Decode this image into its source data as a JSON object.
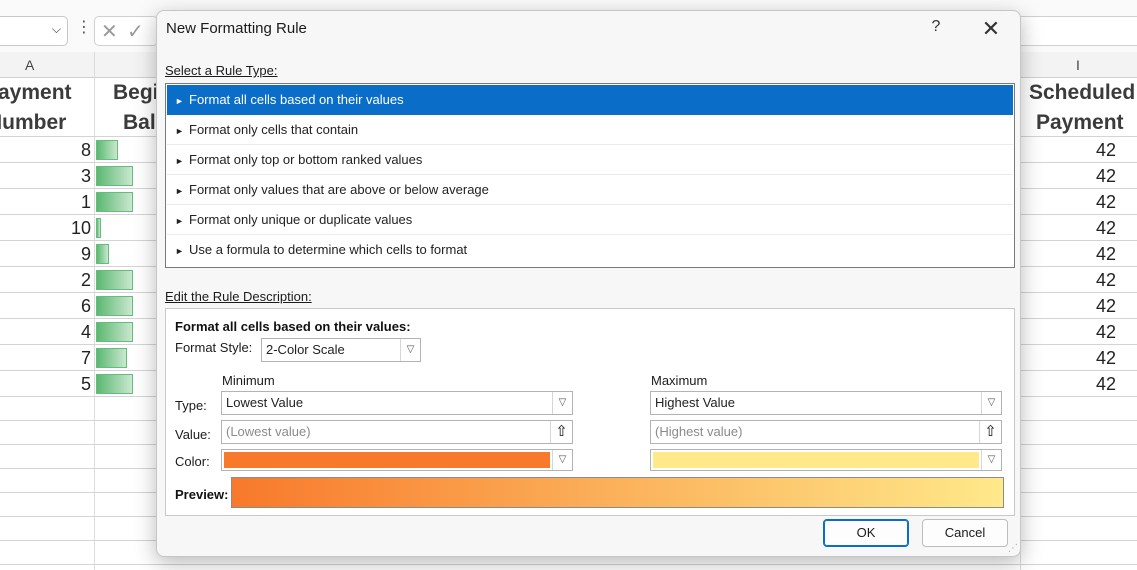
{
  "sheet": {
    "col_headers": [
      "A",
      "I"
    ],
    "header_cells": {
      "a_line1": "ayment",
      "a_line2": "Number",
      "b_line1": "Begi",
      "b_line2": "Bala",
      "i_line1": "Scheduled",
      "i_line2": "Payment"
    },
    "rows": [
      {
        "num": "8",
        "bar_fraction": 0.37,
        "payment": "42"
      },
      {
        "num": "3",
        "bar_fraction": 0.62,
        "payment": "42"
      },
      {
        "num": "1",
        "bar_fraction": 0.62,
        "payment": "42"
      },
      {
        "num": "10",
        "bar_fraction": 0.09,
        "payment": "42"
      },
      {
        "num": "9",
        "bar_fraction": 0.22,
        "payment": "42"
      },
      {
        "num": "2",
        "bar_fraction": 0.62,
        "payment": "42"
      },
      {
        "num": "6",
        "bar_fraction": 0.62,
        "payment": "42"
      },
      {
        "num": "4",
        "bar_fraction": 0.62,
        "payment": "42"
      },
      {
        "num": "7",
        "bar_fraction": 0.52,
        "payment": "42"
      },
      {
        "num": "5",
        "bar_fraction": 0.62,
        "payment": "42"
      }
    ],
    "databar_color": "#63be7b"
  },
  "dialog": {
    "title": "New Formatting Rule",
    "help_label": "?",
    "close_label": "✕",
    "select_rule_label": "Select a Rule Type:",
    "rule_types": [
      "Format all cells based on their values",
      "Format only cells that contain",
      "Format only top or bottom ranked values",
      "Format only values that are above or below average",
      "Format only unique or duplicate values",
      "Use a formula to determine which cells to format"
    ],
    "selected_rule_index": 0,
    "edit_rule_label": "Edit the Rule Description:",
    "description": {
      "heading": "Format all cells based on their values:",
      "format_style_label": "Format Style:",
      "format_style_value": "2-Color Scale",
      "minimum_label": "Minimum",
      "maximum_label": "Maximum",
      "type_label": "Type:",
      "value_label": "Value:",
      "color_label": "Color:",
      "min_type": "Lowest Value",
      "max_type": "Highest Value",
      "min_value_placeholder": "(Lowest value)",
      "max_value_placeholder": "(Highest value)",
      "min_color": "#f8792b",
      "max_color": "#ffe98a",
      "preview_label": "Preview:"
    },
    "ok_label": "OK",
    "cancel_label": "Cancel",
    "accent_color": "#0a6ec9"
  }
}
